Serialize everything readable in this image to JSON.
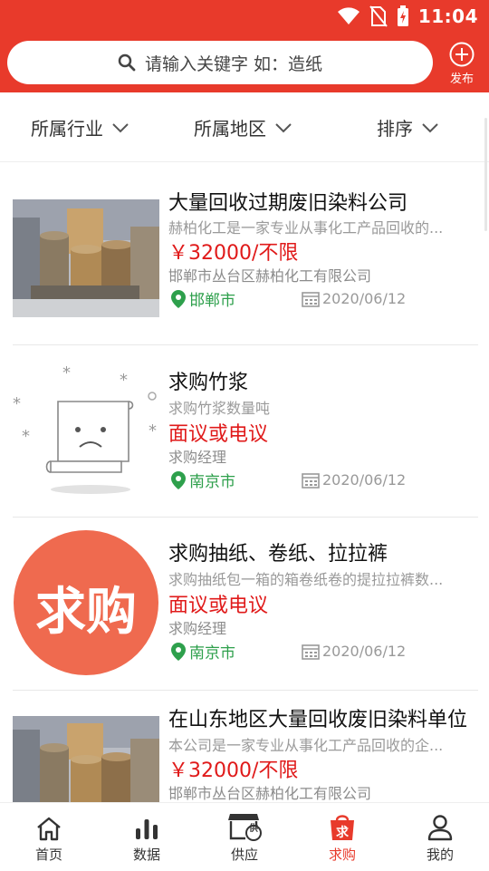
{
  "status_bar": {
    "time": "11:04"
  },
  "search": {
    "placeholder": "请输入关键字 如：造纸"
  },
  "publish_label": "发布",
  "filters": [
    "所属行业",
    "所属地区",
    "排序"
  ],
  "listings": [
    {
      "title": "大量回收过期废旧染料公司",
      "desc": "赫柏化工是一家专业从事化工产品回收的...",
      "price": "￥32000/不限",
      "company": "邯郸市丛台区赫柏化工有限公司",
      "location": "邯郸市",
      "date": "2020/06/12",
      "image": "barrels"
    },
    {
      "title": "求购竹浆",
      "desc": "求购竹浆数量吨",
      "price": "面议或电议",
      "company": "求购经理",
      "location": "南京市",
      "date": "2020/06/12",
      "image": "placeholder-sad-document"
    },
    {
      "title": "求购抽纸、卷纸、拉拉裤",
      "desc": "求购抽纸包一箱的箱卷纸卷的提拉拉裤数...",
      "price": "面议或电议",
      "company": "求购经理",
      "location": "南京市",
      "date": "2020/06/12",
      "image": "qiugou-badge",
      "badge_text": "求购"
    },
    {
      "title": "在山东地区大量回收废旧染料单位",
      "desc": "本公司是一家专业从事化工产品回收的企...",
      "price": "￥32000/不限",
      "company": "邯郸市丛台区赫柏化工有限公司",
      "location": "",
      "date": "",
      "image": "barrels"
    }
  ],
  "bottom_nav": [
    {
      "label": "首页",
      "icon": "home-icon"
    },
    {
      "label": "数据",
      "icon": "bar-chart-icon"
    },
    {
      "label": "供应",
      "icon": "store-icon",
      "badge": "供"
    },
    {
      "label": "求购",
      "icon": "shopping-bag-icon",
      "badge": "求",
      "active": true
    },
    {
      "label": "我的",
      "icon": "person-icon"
    }
  ],
  "colors": {
    "primary": "#e83a2b",
    "price": "#e01a1a",
    "location": "#2ea04c"
  }
}
